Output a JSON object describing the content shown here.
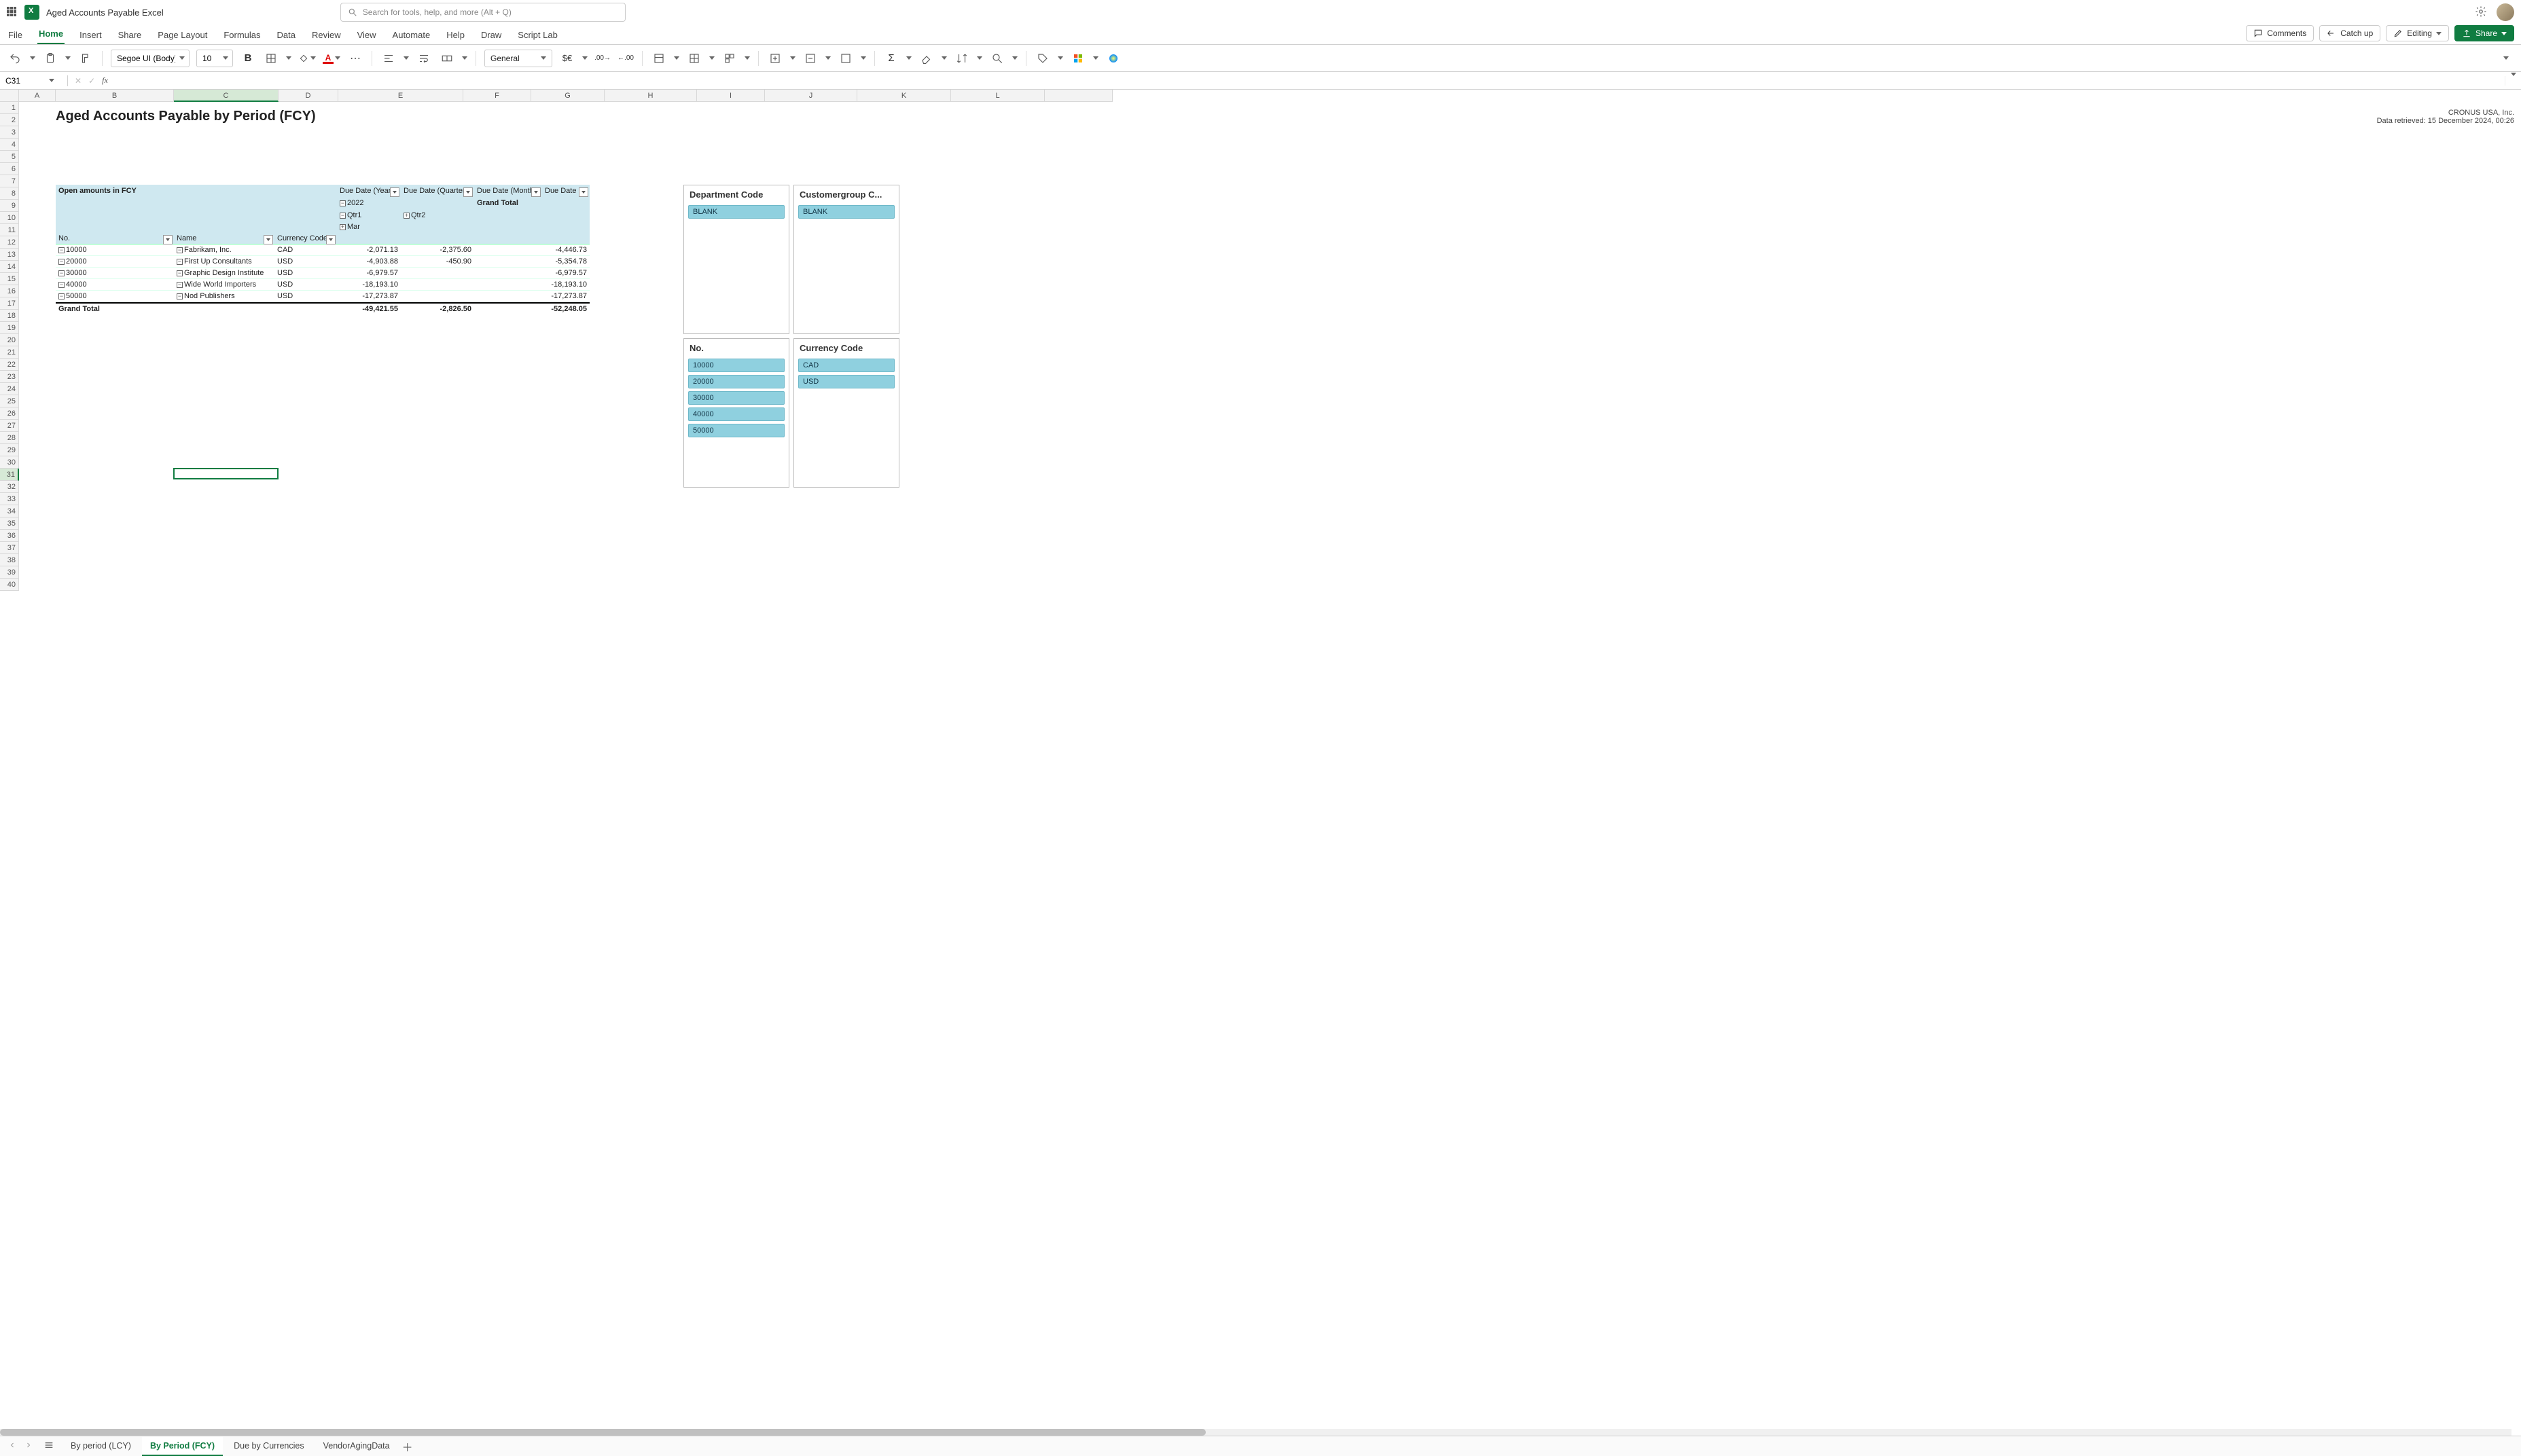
{
  "titlebar": {
    "doc_title": "Aged Accounts Payable Excel"
  },
  "search": {
    "placeholder": "Search for tools, help, and more (Alt + Q)"
  },
  "menubar": {
    "items": [
      "File",
      "Home",
      "Insert",
      "Share",
      "Page Layout",
      "Formulas",
      "Data",
      "Review",
      "View",
      "Automate",
      "Help",
      "Draw",
      "Script Lab"
    ],
    "active_index": 1,
    "buttons": {
      "comments": "Comments",
      "catchup": "Catch up",
      "editing": "Editing",
      "share": "Share"
    }
  },
  "ribbon": {
    "font_name": "Segoe UI (Body)",
    "font_size": "10",
    "number_format": "General"
  },
  "namebox": {
    "value": "C31"
  },
  "columns": [
    "A",
    "B",
    "C",
    "D",
    "E",
    "F",
    "G",
    "H",
    "I",
    "J",
    "K",
    "L"
  ],
  "active_col_index": 2,
  "row_count": 40,
  "active_row": 31,
  "report": {
    "title": "Aged Accounts Payable by Period (FCY)",
    "company": "CRONUS USA, Inc.",
    "retrieved": "Data retrieved: 15 December 2024, 00:26",
    "pivot": {
      "corner_label": "Open amounts in FCY",
      "col_fields": [
        "Due Date (Year)",
        "Due Date (Quarter)",
        "Due Date (Month)",
        "Due Date"
      ],
      "year": "2022",
      "quarters": [
        "Qtr1",
        "Qtr2"
      ],
      "month": "Mar",
      "grand_total_label": "Grand Total",
      "row_headers": [
        "No.",
        "Name",
        "Currency Code"
      ],
      "rows": [
        {
          "no": "10000",
          "name": "Fabrikam, Inc.",
          "cur": "CAD",
          "q1": "-2,071.13",
          "q2": "-2,375.60",
          "tot": "-4,446.73"
        },
        {
          "no": "20000",
          "name": "First Up Consultants",
          "cur": "USD",
          "q1": "-4,903.88",
          "q2": "-450.90",
          "tot": "-5,354.78"
        },
        {
          "no": "30000",
          "name": "Graphic Design Institute",
          "cur": "USD",
          "q1": "-6,979.57",
          "q2": "",
          "tot": "-6,979.57"
        },
        {
          "no": "40000",
          "name": "Wide World Importers",
          "cur": "USD",
          "q1": "-18,193.10",
          "q2": "",
          "tot": "-18,193.10"
        },
        {
          "no": "50000",
          "name": "Nod Publishers",
          "cur": "USD",
          "q1": "-17,273.87",
          "q2": "",
          "tot": "-17,273.87"
        }
      ],
      "grand_total": {
        "label": "Grand Total",
        "q1": "-49,421.55",
        "q2": "-2,826.50",
        "tot": "-52,248.05"
      }
    }
  },
  "slicers": {
    "dept": {
      "title": "Department Code",
      "items": [
        "BLANK"
      ]
    },
    "custgroup": {
      "title": "Customergroup C...",
      "items": [
        "BLANK"
      ]
    },
    "no": {
      "title": "No.",
      "items": [
        "10000",
        "20000",
        "30000",
        "40000",
        "50000"
      ]
    },
    "currency": {
      "title": "Currency Code",
      "items": [
        "CAD",
        "USD"
      ]
    }
  },
  "sheets": {
    "tabs": [
      "By period (LCY)",
      "By Period (FCY)",
      "Due by Currencies",
      "VendorAgingData"
    ],
    "active_index": 1
  }
}
